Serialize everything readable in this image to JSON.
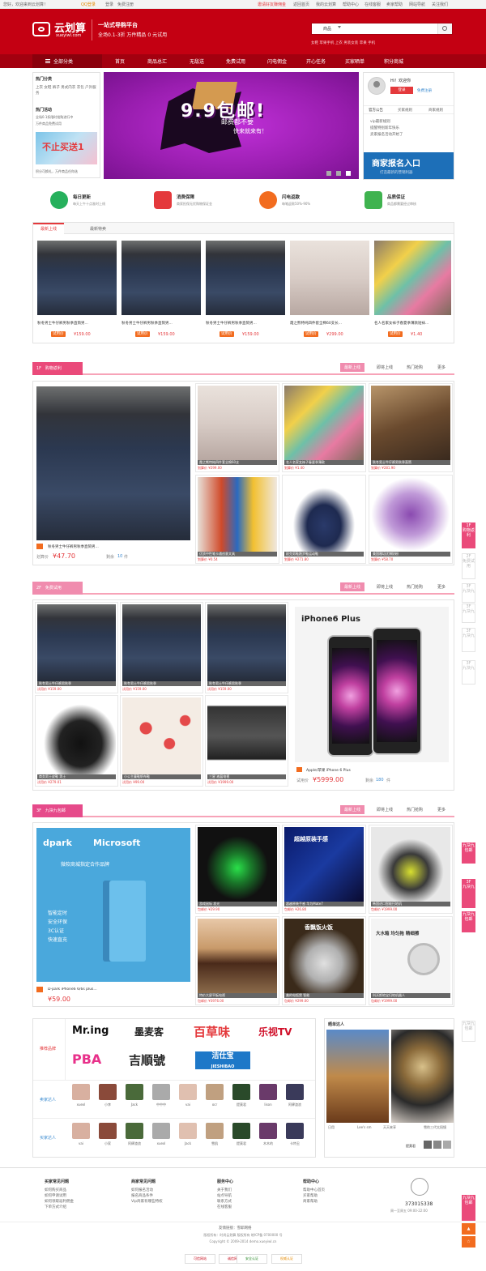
{
  "topbar": {
    "welcome": "您好，欢迎来到云划算！",
    "login": "登录",
    "register": "免费注册",
    "qq_login": "QQ登录",
    "promo": "邀请好友赚佣金",
    "links": [
      "返回首页",
      "我的云划算",
      "帮助中心",
      "在线客服",
      "卖家帮助",
      "网站导航",
      "关注我们"
    ]
  },
  "header": {
    "logo_text": "云划算",
    "logo_url": "xueyiwl.com",
    "slogan1": "一站式导购平台",
    "slogan2": "全场0.1-3折 万件精品 0 元试用",
    "search_category": "商品",
    "hot_keywords": "女鞋 苹果手机 上衣 男装女装 苹果 手机"
  },
  "nav": {
    "all": "全部分类",
    "items": [
      "首页",
      "商品总汇",
      "无敌送",
      "免费试用",
      "闪电佣金",
      "开心任务",
      "买家晒单",
      "积分商城"
    ]
  },
  "sidebar": {
    "hot_cat_title": "热门分类",
    "hot_cats": "上衣 女鞋 裤子 男式内衣 衣包 户外服务",
    "hot_act_title": "热门活动",
    "acts": [
      "全场0.1折限时抢购进行中",
      "万件商品免费试用"
    ],
    "banner_text": "不止买送1",
    "points_text": "积分可换礼，万件商品任你选"
  },
  "banner": {
    "big_text": "9.9包邮!",
    "sub_text": "邮费都不要",
    "sub_text2": "快来就来有！"
  },
  "user_panel": {
    "greeting": "Hi！欢迎你",
    "login_btn": "登录",
    "free_reg": "免费注册",
    "tabs": [
      "官方公告",
      "买家规则",
      "商家规则"
    ],
    "notices": [
      "vip最新规则",
      "提醒特别新年快乐",
      "卖家报名活动开始了"
    ],
    "promo_box": "商家报名入口",
    "promo_sub": "打造最新的营销利器"
  },
  "features": [
    {
      "title": "每日更新",
      "sub": "每天上午十点准时上线",
      "color": "#26b05c"
    },
    {
      "title": "消费保障",
      "sub": "商家担保无忧购物保证金",
      "color": "#e4393c"
    },
    {
      "title": "闪电返款",
      "sub": "每笔返款50%-90%",
      "color": "#f26c1f"
    },
    {
      "title": "品质保证",
      "sub": "商品都需要经过审核",
      "color": "#3fb34f"
    }
  ],
  "newarrivals": {
    "tabs": [
      "最新上线",
      "最新特卖"
    ],
    "items": [
      {
        "title": "秋冬男士牛仔裤男秋季直筒男...",
        "tag": "试用价",
        "price": "¥159.00"
      },
      {
        "title": "秋冬男士牛仔裤男秋季直筒男...",
        "tag": "试用价",
        "price": "¥159.00"
      },
      {
        "title": "秋冬男士牛仔裤男秋季直筒男...",
        "tag": "试用价",
        "price": "¥159.00"
      },
      {
        "title": "霞之熊特纯四件套全棉60支长...",
        "tag": "试用价",
        "price": "¥299.00"
      },
      {
        "title": "名人名家女袜子春夏季薄款短袜...",
        "tag": "试用价",
        "price": "¥1.40"
      }
    ]
  },
  "floor1": {
    "badge": "1F",
    "title": "购物返利",
    "tabs": [
      "最新上线",
      "即将上线",
      "热门抢购",
      "更多"
    ],
    "big_title": "秋冬男士牛仔裤男秋季直筒男...",
    "big_price_label": "划算价",
    "big_price": "¥47.70",
    "big_left": "剩余",
    "big_left_n": "10",
    "big_unit": "件",
    "cells": [
      {
        "cap": "霞之熊特纯四件套全棉60支",
        "pr": "划算价 ¥299.00"
      },
      {
        "cap": "名人名家女袜子春夏季薄款",
        "pr": "划算价 ¥1.40"
      },
      {
        "cap": "秋冬男士牛仔裤男秋季直筒",
        "pr": "划算价 ¥281.90"
      },
      {
        "cap": "优质中性笔卡通创意文具",
        "pr": "划算价 ¥0.54"
      },
      {
        "cap": "耐克男鞋跑步鞋运动鞋",
        "pr": "划算价 ¥271.80"
      },
      {
        "cap": "美国雅培优博奶粉",
        "pr": "划算价 ¥58.70"
      }
    ]
  },
  "floor2": {
    "badge": "2F",
    "title": "免费试用",
    "tabs": [
      "最新上线",
      "即将上线",
      "热门抢购",
      "更多"
    ],
    "phone_brand": "iPhone6 Plus",
    "phone_title": "Apple/苹果 iPhone 6 Plus",
    "phone_price_label": "试用价",
    "phone_price": "¥5999.00",
    "phone_left": "剩余",
    "phone_left_n": "180",
    "phone_unit": "件",
    "cells": [
      {
        "cap": "秋冬男士牛仔裤男秋季",
        "pr": "试用价 ¥159.00"
      },
      {
        "cap": "秋冬男士牛仔裤男秋季",
        "pr": "试用价 ¥159.00"
      },
      {
        "cap": "秋冬男士牛仔裤男秋季",
        "pr": "试用价 ¥159.00"
      },
      {
        "cap": "商务男士皮鞋 男士",
        "pr": "试用价 ¥279.01"
      },
      {
        "cap": "小公主童鞋帆布鞋",
        "pr": "试用价 ¥99.00"
      },
      {
        "cap": "三星 液晶电视",
        "pr": "试用价 ¥1999.00"
      }
    ]
  },
  "floor3": {
    "badge": "3F",
    "title": "九块九包邮",
    "tabs": [
      "最新上线",
      "即将上线",
      "热门抢购",
      "更多"
    ],
    "big_brand1": "dpark",
    "big_brand2": "Microsoft",
    "big_sub": "微软商城指定合作品牌",
    "big_feats": [
      "智能定时",
      "安全环保",
      "3C认证",
      "快速直充"
    ],
    "big_title": "D-park iPhone6 6/6s plus...",
    "big_price": "¥59.00",
    "cells": [
      {
        "cap": "游戏鼠标 发光",
        "pr": "包邮价 ¥29.90"
      },
      {
        "cap": "超越原装手感 华为Mate7",
        "pr": "包邮价 ¥26.80"
      },
      {
        "cap": "韩国进口智能扫地机",
        "pr": "包邮价 ¥1999.00"
      },
      {
        "cap": "特价大屏平板电视",
        "pr": "包邮价 ¥3976.00"
      },
      {
        "cap": "美的电饭煲 智能",
        "pr": "包邮价 ¥299.00"
      },
      {
        "cap": "科沃斯地宝扫地机器人",
        "pr": "包邮价 ¥1999.00"
      }
    ],
    "cell_titles": [
      "超越原装手感",
      "香飘饭火饭",
      "大水箱 均匀拖 精细擦"
    ]
  },
  "brands": {
    "label": "推荐品牌",
    "logos": [
      "Mr.ing",
      "墨麦客",
      "百草味",
      "乐视TV",
      "PBA",
      "吉順號",
      "洁仕宝"
    ],
    "logo_sub": "JIESHIBAO",
    "sellers_label": "卖家达人",
    "buyers_label": "买家达人",
    "sellers": [
      "xuexl",
      "小李",
      "Jack",
      "中中中",
      "vai",
      "ocr",
      "提莫君",
      "lison",
      "阿肆渣浪"
    ],
    "buyers": [
      "vai",
      "小家",
      "阿肆渣浪",
      "xuexl",
      "Jack",
      "雪肌",
      "提莫君",
      "木木的",
      "卡特丑"
    ],
    "show_title": "晒单达人",
    "show_items": [
      "日用",
      "Lee's sm",
      "天天来享",
      "沙漠风景",
      "雪豹三代太阳镜"
    ],
    "show_user": "提莫君"
  },
  "footer": {
    "cols": [
      {
        "title": "买家常见问题",
        "items": [
          "如何购买商品",
          "如何申请试用",
          "如何领取返利佣金",
          "下单方式介绍"
        ]
      },
      {
        "title": "商家常见问题",
        "items": [
          "如何报名活动",
          "报名商品条件",
          "Vip商家有哪些特权"
        ]
      },
      {
        "title": "服务中心",
        "items": [
          "关于我们",
          "站点导航",
          "联系方式",
          "在线客服"
        ]
      },
      {
        "title": "帮助中心",
        "items": [
          "帮助中心首页",
          "买家帮助",
          "商家帮助"
        ]
      }
    ],
    "qq": "373015338",
    "service_time": "周一至周五 09:00-22:00",
    "links_label": "友情链接：",
    "links": "雪耶网络",
    "copyright1": "版权所有：时尚云划算 版权所有 皖ICP备 0700000 号",
    "copyright2": "Copyright © 2009-2014 demo.xueyiwl.cn",
    "badges": [
      "可信网站",
      "诚信网站",
      "安全认证",
      "权威认证"
    ]
  },
  "elevator": {
    "items": [
      "1F\n购物返利",
      "2F\n免费试用",
      "3F\n九块九",
      "3F\n九块九",
      "3F\n九块九",
      "3F\n九块九",
      "九块九包邮",
      "九块九包邮",
      "九块九包邮",
      "九块九包邮"
    ],
    "top_label": "顶部"
  }
}
